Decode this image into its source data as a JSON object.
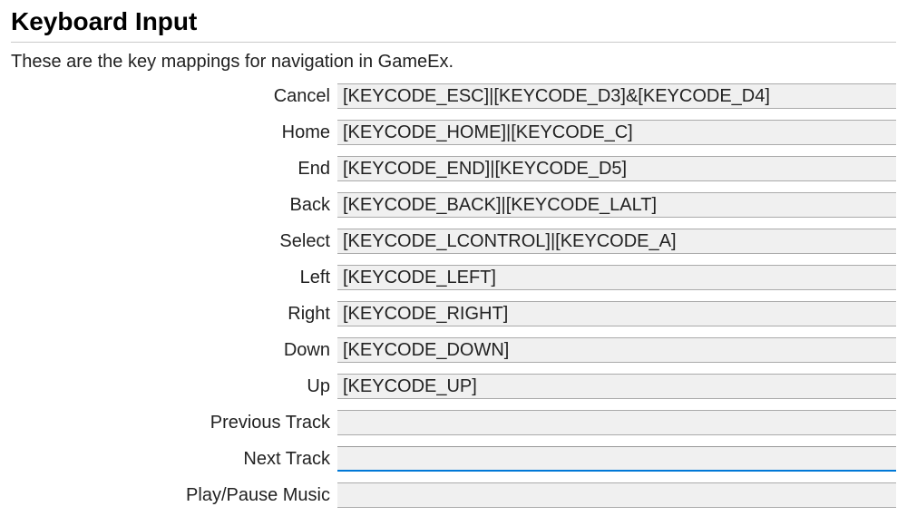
{
  "title": "Keyboard Input",
  "description": "These are the key mappings for navigation in GameEx.",
  "focusedFieldIndex": 10,
  "fields": [
    {
      "label": "Cancel",
      "value": "[KEYCODE_ESC]|[KEYCODE_D3]&[KEYCODE_D4]"
    },
    {
      "label": "Home",
      "value": "[KEYCODE_HOME]|[KEYCODE_C]"
    },
    {
      "label": "End",
      "value": "[KEYCODE_END]|[KEYCODE_D5]"
    },
    {
      "label": "Back",
      "value": "[KEYCODE_BACK]|[KEYCODE_LALT]"
    },
    {
      "label": "Select",
      "value": "[KEYCODE_LCONTROL]|[KEYCODE_A]"
    },
    {
      "label": "Left",
      "value": "[KEYCODE_LEFT]"
    },
    {
      "label": "Right",
      "value": "[KEYCODE_RIGHT]"
    },
    {
      "label": "Down",
      "value": "[KEYCODE_DOWN]"
    },
    {
      "label": "Up",
      "value": "[KEYCODE_UP]"
    },
    {
      "label": "Previous Track",
      "value": ""
    },
    {
      "label": "Next Track",
      "value": ""
    },
    {
      "label": "Play/Pause Music",
      "value": ""
    }
  ]
}
